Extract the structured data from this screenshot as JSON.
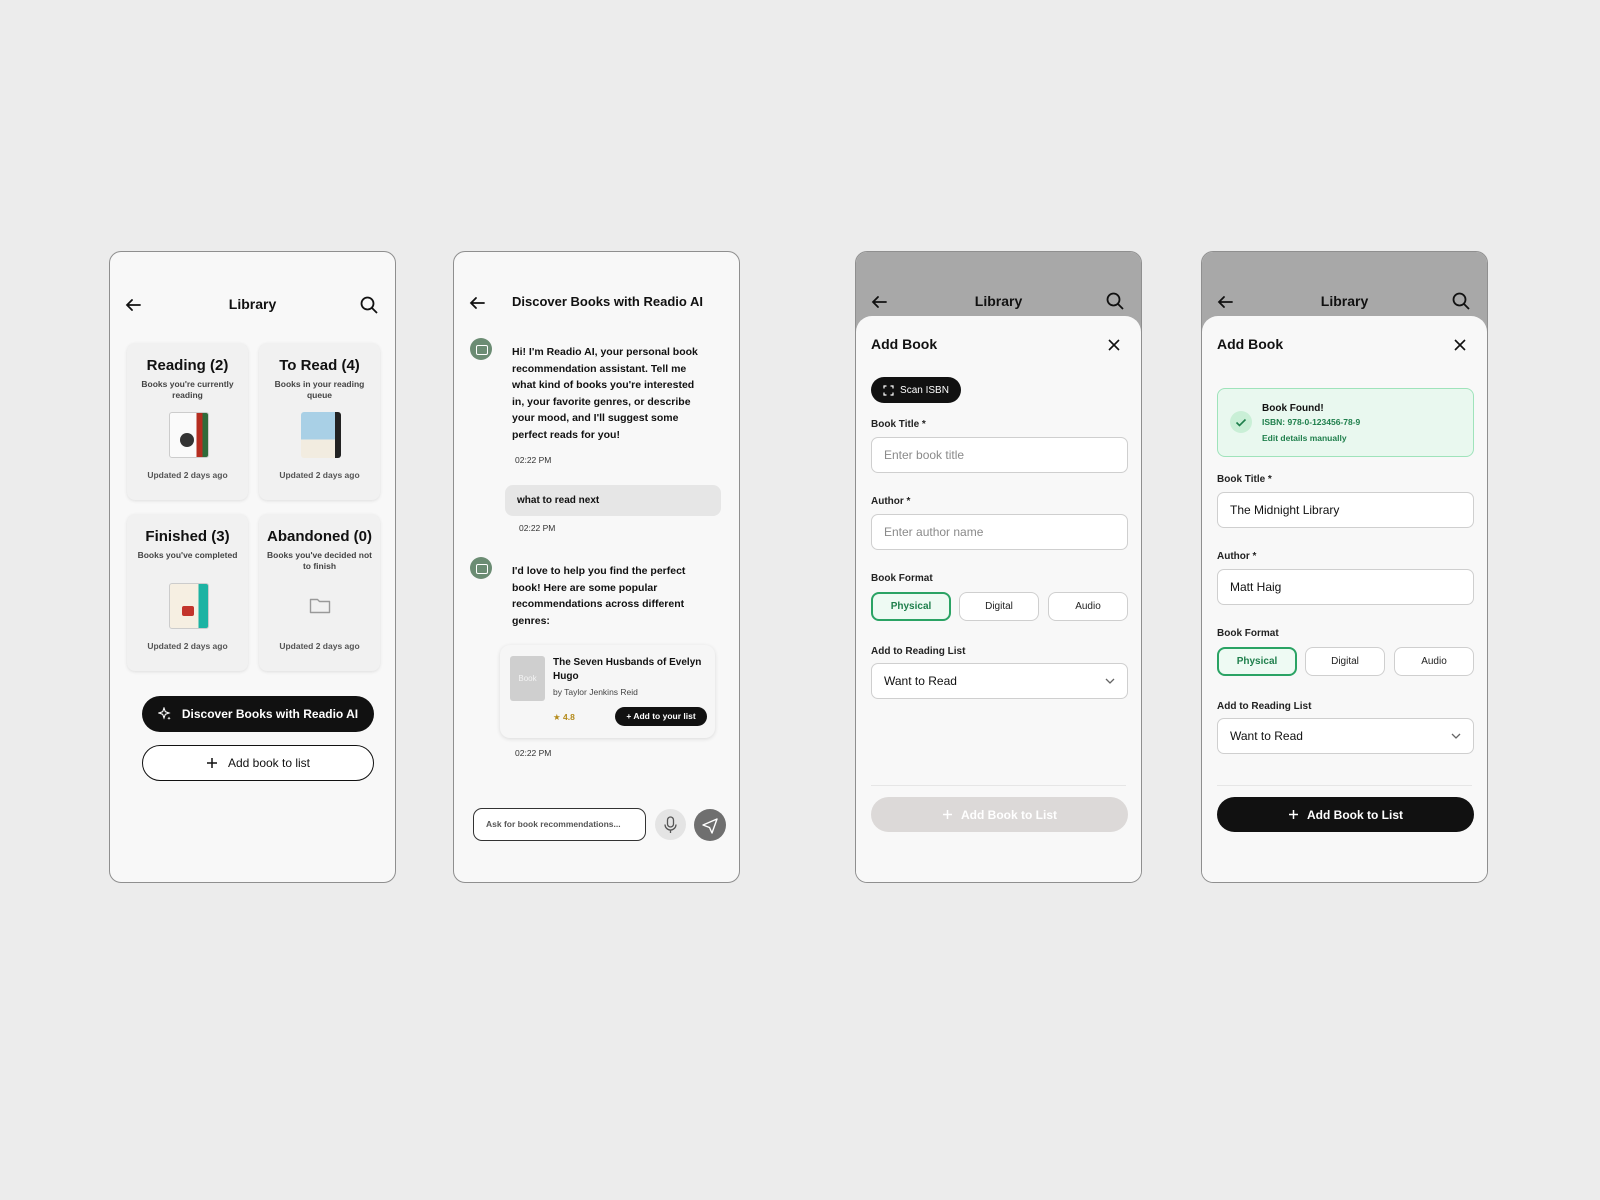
{
  "library": {
    "title": "Library",
    "cards": [
      {
        "heading": "Reading (2)",
        "desc": "Books you're currently reading",
        "updated": "Updated 2 days ago"
      },
      {
        "heading": "To Read (4)",
        "desc": "Books in your reading queue",
        "updated": "Updated 2 days ago"
      },
      {
        "heading": "Finished (3)",
        "desc": "Books you've completed",
        "updated": "Updated 2 days ago"
      },
      {
        "heading": "Abandoned (0)",
        "desc": "Books you've decided not to finish",
        "updated": "Updated 2 days ago"
      }
    ],
    "discover_label": "Discover Books with Readio AI",
    "add_label": "Add book to list"
  },
  "chat": {
    "title": "Discover Books with Readio AI",
    "bot_msg_1": "Hi! I'm Readio AI, your personal book recommendation assistant. Tell me what kind of books you're interested in, your favorite genres, or describe your mood, and I'll suggest some perfect reads for you!",
    "time_1": "02:22 PM",
    "user_msg": "what to read next",
    "time_2": "02:22 PM",
    "bot_msg_2": "I'd love to help you find the perfect book! Here are some popular recommendations across different genres:",
    "book": {
      "thumb": "Book",
      "title": "The Seven Husbands of Evelyn Hugo",
      "author": "by Taylor Jenkins Reid",
      "rating": "★ 4.8",
      "add_label": "+ Add to your list"
    },
    "time_3": "02:22 PM",
    "input_placeholder": "Ask for book recommendations..."
  },
  "add_empty": {
    "bg_title": "Library",
    "title": "Add Book",
    "scan_label": "Scan ISBN",
    "title_label": "Book Title *",
    "title_placeholder": "Enter book title",
    "author_label": "Author *",
    "author_placeholder": "Enter author name",
    "format_label": "Book Format",
    "formats": [
      "Physical",
      "Digital",
      "Audio"
    ],
    "list_label": "Add to Reading List",
    "list_value": "Want to Read",
    "cta": "Add Book to List"
  },
  "add_filled": {
    "bg_title": "Library",
    "title": "Add Book",
    "found_title": "Book Found!",
    "found_isbn": "ISBN: 978-0-123456-78-9",
    "found_edit": "Edit details manually",
    "title_label": "Book Title *",
    "title_value": "The Midnight Library",
    "author_label": "Author *",
    "author_value": "Matt Haig",
    "format_label": "Book Format",
    "formats": [
      "Physical",
      "Digital",
      "Audio"
    ],
    "list_label": "Add to Reading List",
    "list_value": "Want to Read",
    "cta": "Add Book to List"
  },
  "colors": {
    "accent_green": "#2aa364",
    "dark": "#111111",
    "page_bg": "#ececec"
  }
}
